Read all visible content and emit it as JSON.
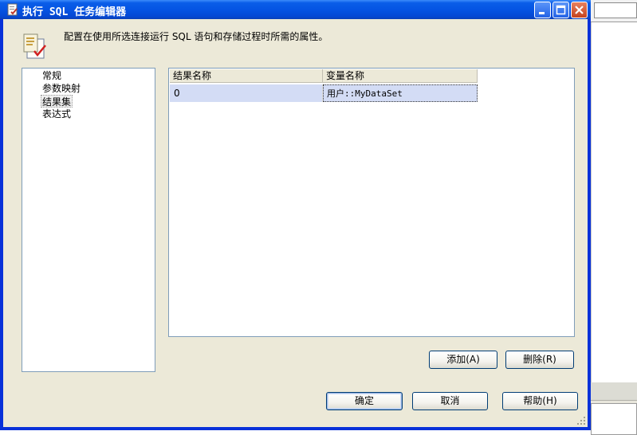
{
  "window": {
    "title": "执行 SQL 任务编辑器",
    "minimize_icon": "minimize-icon",
    "maximize_icon": "maximize-icon",
    "close_icon": "close-icon"
  },
  "header": {
    "icon": "task-icon",
    "description": "配置在使用所选连接运行 SQL 语句和存储过程时所需的属性。"
  },
  "navigation": {
    "items": [
      {
        "label": "常规"
      },
      {
        "label": "参数映射"
      },
      {
        "label": "结果集",
        "selected": true
      },
      {
        "label": "表达式"
      }
    ]
  },
  "result_grid": {
    "columns": [
      "结果名称",
      "变量名称"
    ],
    "rows": [
      {
        "result_name": "0",
        "variable_name": "用户::MyDataSet"
      }
    ]
  },
  "buttons": {
    "add": "添加(A)",
    "delete": "删除(R)",
    "ok": "确定",
    "cancel": "取消",
    "help": "帮助(H)"
  },
  "colors": {
    "titlebar": "#0554e3",
    "dialog_bg": "#ece9d8",
    "selection": "#d3dcf5"
  }
}
